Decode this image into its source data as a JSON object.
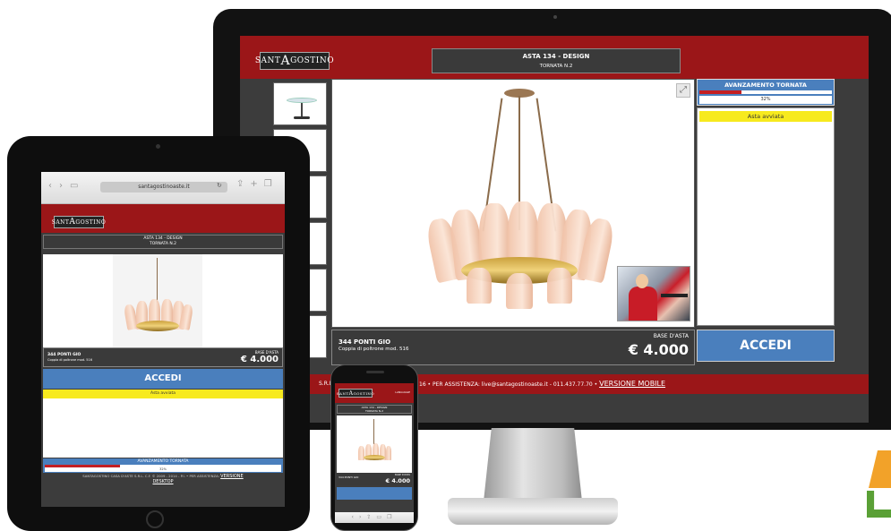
{
  "desktop": {
    "logo": {
      "first": "SANT",
      "mid": "A",
      "last": "GOSTINO"
    },
    "auction_title": "ASTA 134 - DESIGN",
    "session": "TORNATA N.2",
    "progress": {
      "label": "AVANZAMENTO TORNATA",
      "percent_text": "32%",
      "value": 0.32
    },
    "status": "Asta avviata",
    "lot": {
      "title": "344 PONTI GIO",
      "description": "Coppia di poltrone mod. 516",
      "base_label": "BASE D'ASTA",
      "base_value": "€ 4.000"
    },
    "login_label": "ACCEDI",
    "footer": {
      "left": "S.R.L",
      "right": "16  •  PER ASSISTENZA: live@santagostinoaste.it - 011.437.77.70  •",
      "mobile_link": "VERSIONE MOBILE"
    }
  },
  "tablet": {
    "url": "santagostinoaste.it",
    "auction_title": "ASTA 134 - DESIGN",
    "session": "TORNATA N.2",
    "lot": {
      "title": "344 PONTI GIO",
      "description": "Coppia di poltrone mod. 516",
      "base_label": "BASE D'ASTA",
      "base_value": "€ 4.000"
    },
    "login_label": "ACCEDI",
    "status": "Asta avviata",
    "progress": {
      "label": "AVANZAMENTO TORNATA",
      "percent_text": "32%",
      "value": 0.32
    },
    "footer": {
      "text": "SANTAGOSTINO CASA D'ASTE S.R.L. C.F. © 2009 - 2014 - P.I.  •  PER ASSISTENZA:",
      "desktop_link_top": "VERSIONE",
      "desktop_link_bottom": "DESKTOP"
    }
  },
  "phone": {
    "auction_title": "ASTA 134 - DESIGN",
    "session": "TORNATA N.2",
    "lot_title": "344 PONTI GIO",
    "base_label": "BASE D'ASTA",
    "base_value": "€ 4.000",
    "lang": "LANGUAGE"
  },
  "colors": {
    "brand_red": "#9b1618",
    "accent_blue": "#4a7fbd",
    "status_yellow": "#f7ea1e",
    "panel_dark": "#3c3c3c"
  },
  "icons": [
    "expand-icon",
    "back-icon",
    "forward-icon",
    "bookmarks-icon",
    "reload-icon",
    "share-icon",
    "add-icon",
    "tabs-icon"
  ]
}
